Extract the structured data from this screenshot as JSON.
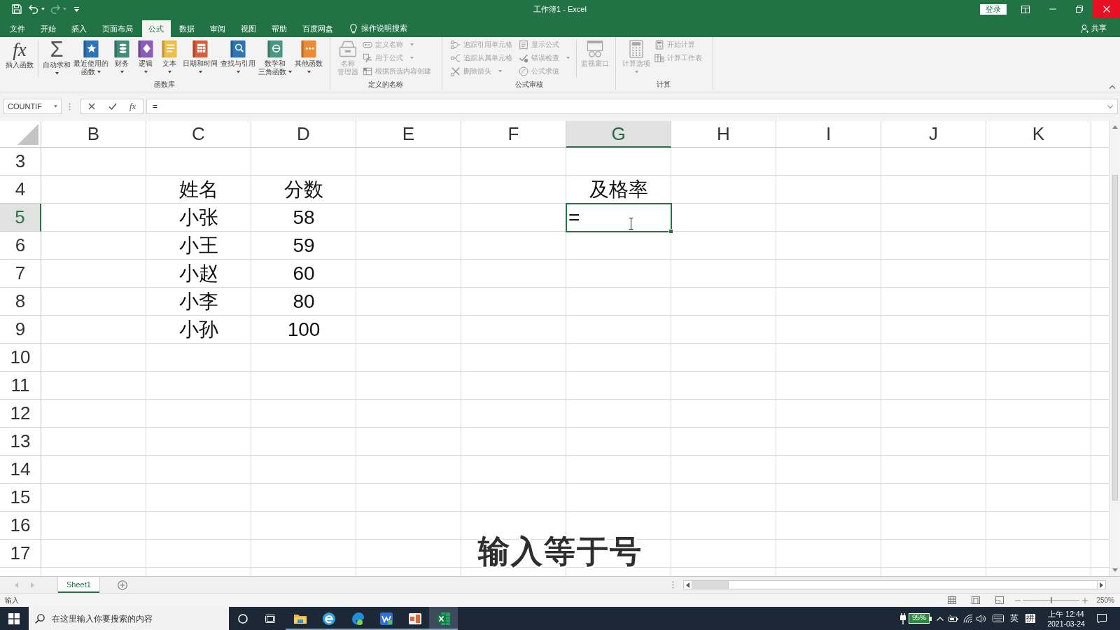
{
  "window": {
    "title": "工作簿1 - Excel",
    "sign_in": "登录"
  },
  "ribbon_tabs": [
    {
      "label": "文件",
      "selected": false
    },
    {
      "label": "开始",
      "selected": false
    },
    {
      "label": "插入",
      "selected": false
    },
    {
      "label": "页面布局",
      "selected": false
    },
    {
      "label": "公式",
      "selected": true
    },
    {
      "label": "数据",
      "selected": false
    },
    {
      "label": "审阅",
      "selected": false
    },
    {
      "label": "视图",
      "selected": false
    },
    {
      "label": "帮助",
      "selected": false
    },
    {
      "label": "百度网盘",
      "selected": false
    }
  ],
  "tell_me": "操作说明搜索",
  "share": "共享",
  "ribbon_groups": [
    {
      "label": "函数库",
      "items": [
        {
          "kind": "large",
          "glyph": "fx",
          "label_lines": [
            "插入函数"
          ],
          "dropdown": false,
          "disabled": false
        },
        {
          "kind": "large",
          "glyph": "Σ",
          "label_lines": [
            "自动求和"
          ],
          "dropdown": true,
          "disabled": false
        },
        {
          "kind": "large",
          "label_lines": [
            "最近使用的",
            "函数"
          ],
          "dropdown": true,
          "disabled": false
        },
        {
          "kind": "large",
          "label_lines": [
            "财务"
          ],
          "dropdown": true,
          "disabled": false
        },
        {
          "kind": "large",
          "label_lines": [
            "逻辑"
          ],
          "dropdown": true,
          "disabled": false
        },
        {
          "kind": "large",
          "label_lines": [
            "文本"
          ],
          "dropdown": true,
          "disabled": false
        },
        {
          "kind": "large",
          "label_lines": [
            "日期和时间"
          ],
          "dropdown": true,
          "disabled": false
        },
        {
          "kind": "large",
          "label_lines": [
            "查找与引用"
          ],
          "dropdown": true,
          "disabled": false
        },
        {
          "kind": "large",
          "label_lines": [
            "数学和",
            "三角函数"
          ],
          "dropdown": true,
          "disabled": false
        },
        {
          "kind": "large",
          "label_lines": [
            "其他函数"
          ],
          "dropdown": true,
          "disabled": false
        }
      ]
    },
    {
      "label": "定义的名称",
      "items": [
        {
          "kind": "large",
          "label_lines": [
            "名称",
            "管理器"
          ],
          "dropdown": false,
          "disabled": true
        },
        {
          "kind": "stack",
          "children": [
            {
              "label": "定义名称",
              "dropdown": true,
              "disabled": true
            },
            {
              "label": "用于公式",
              "dropdown": true,
              "disabled": true
            },
            {
              "label": "根据所选内容创建",
              "dropdown": false,
              "disabled": true
            }
          ]
        }
      ]
    },
    {
      "label": "公式审核",
      "items": [
        {
          "kind": "stack",
          "children": [
            {
              "label": "追踪引用单元格",
              "dropdown": false,
              "disabled": true
            },
            {
              "label": "追踪从属单元格",
              "dropdown": false,
              "disabled": true
            },
            {
              "label": "删除箭头",
              "dropdown": true,
              "disabled": true
            }
          ]
        },
        {
          "kind": "stack",
          "children": [
            {
              "label": "显示公式",
              "dropdown": false,
              "disabled": true
            },
            {
              "label": "错误检查",
              "dropdown": true,
              "disabled": true
            },
            {
              "label": "公式求值",
              "dropdown": false,
              "disabled": true
            }
          ]
        },
        {
          "kind": "large",
          "label_lines": [
            "监视窗口"
          ],
          "dropdown": false,
          "disabled": true
        }
      ]
    },
    {
      "label": "计算",
      "items": [
        {
          "kind": "large",
          "label_lines": [
            "计算选项"
          ],
          "dropdown": true,
          "disabled": true
        },
        {
          "kind": "stack",
          "children": [
            {
              "label": "开始计算",
              "dropdown": false,
              "disabled": true
            },
            {
              "label": "计算工作表",
              "dropdown": false,
              "disabled": true
            }
          ]
        }
      ]
    }
  ],
  "formula_bar": {
    "name_box": "COUNTIF",
    "function_glyph": "fx",
    "value": "="
  },
  "sheet": {
    "columns": [
      {
        "label": "B",
        "selected": false
      },
      {
        "label": "C",
        "selected": false
      },
      {
        "label": "D",
        "selected": false
      },
      {
        "label": "E",
        "selected": false
      },
      {
        "label": "F",
        "selected": false
      },
      {
        "label": "G",
        "selected": true
      },
      {
        "label": "H",
        "selected": false
      },
      {
        "label": "I",
        "selected": false
      },
      {
        "label": "J",
        "selected": false
      },
      {
        "label": "K",
        "selected": false
      }
    ],
    "rows": [
      {
        "label": "3",
        "selected": false
      },
      {
        "label": "4",
        "selected": false,
        "cells": [
          null,
          "姓名",
          "分数",
          null,
          null,
          "及格率"
        ]
      },
      {
        "label": "5",
        "selected": true,
        "cells": [
          null,
          "小张",
          "58",
          null,
          null,
          "="
        ]
      },
      {
        "label": "6",
        "selected": false,
        "cells": [
          null,
          "小王",
          "59"
        ]
      },
      {
        "label": "7",
        "selected": false,
        "cells": [
          null,
          "小赵",
          "60"
        ]
      },
      {
        "label": "8",
        "selected": false,
        "cells": [
          null,
          "小李",
          "80"
        ]
      },
      {
        "label": "9",
        "selected": false,
        "cells": [
          null,
          "小孙",
          "100"
        ]
      },
      {
        "label": "10",
        "selected": false
      },
      {
        "label": "11",
        "selected": false
      },
      {
        "label": "12",
        "selected": false
      },
      {
        "label": "13",
        "selected": false
      },
      {
        "label": "14",
        "selected": false
      },
      {
        "label": "15",
        "selected": false
      },
      {
        "label": "16",
        "selected": false
      },
      {
        "label": "17",
        "selected": false
      }
    ]
  },
  "caption": "输入等于号",
  "sheet_tabs": [
    {
      "label": "Sheet1",
      "selected": true
    }
  ],
  "status_bar": {
    "mode": "输入",
    "zoom": {
      "label": "250%",
      "level": 0.5
    }
  },
  "taskbar": {
    "search_placeholder": "在这里输入你要搜索的内容",
    "apps": [
      {
        "running": true,
        "selected": false
      },
      {
        "running": true,
        "selected": false
      },
      {
        "running": true,
        "selected": false
      },
      {
        "running": true,
        "selected": false
      },
      {
        "running": true,
        "selected": false
      },
      {
        "running": true,
        "selected": true
      }
    ],
    "battery": "95%",
    "input_language": "英",
    "input_mode": "拼",
    "time": "上午 12:44",
    "date": "2021-03-24"
  }
}
